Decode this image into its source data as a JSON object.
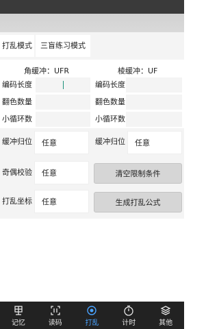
{
  "mode_tabs": [
    {
      "label": "打乱模式"
    },
    {
      "label": "三盲练习模式"
    }
  ],
  "corner_header": "角缓冲：UFR",
  "edge_header": "棱缓冲：UF",
  "left_fields": [
    {
      "label": "编码长度",
      "value": ""
    },
    {
      "label": "翻色数量",
      "value": ""
    },
    {
      "label": "小循环数",
      "value": ""
    }
  ],
  "right_fields": [
    {
      "label": "编码长度",
      "value": ""
    },
    {
      "label": "翻色数量",
      "value": ""
    },
    {
      "label": "小循环数",
      "value": ""
    }
  ],
  "buffer_left": {
    "label": "缓冲归位",
    "value": "任意"
  },
  "buffer_right": {
    "label": "缓冲归位",
    "value": "任意"
  },
  "parity": {
    "label": "奇偶校验",
    "value": "任意"
  },
  "scramble_coord": {
    "label": "打乱坐标",
    "value": "任意"
  },
  "clear_button": "清空限制条件",
  "generate_button": "生成打乱公式",
  "colors": {
    "active": "#4aa3ff",
    "nav_bg": "#222222",
    "cursor": "#1a8f7a"
  },
  "nav": [
    {
      "label": "记忆",
      "icon": "memory-icon"
    },
    {
      "label": "读码",
      "icon": "read-code-icon"
    },
    {
      "label": "打乱",
      "icon": "scramble-icon",
      "active": true
    },
    {
      "label": "计时",
      "icon": "timer-icon"
    },
    {
      "label": "其他",
      "icon": "layers-icon"
    }
  ]
}
